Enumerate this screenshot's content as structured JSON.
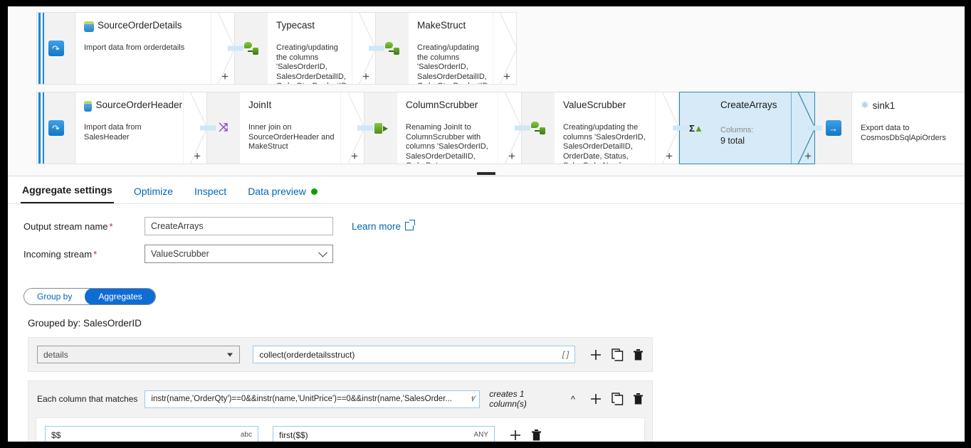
{
  "canvas": {
    "rows": [
      {
        "source": {
          "icon": "sql-database-icon",
          "title": "SourceOrderDetails",
          "desc": "Import data from orderdetails",
          "handle_icon": "source-import-icon"
        },
        "nodes": [
          {
            "conn_icon": "derived-column-icon",
            "title": "Typecast",
            "desc": "Creating/updating the columns 'SalesOrderID, SalesOrderDetailID, OrderQty, ProductID, UnitPrice,"
          },
          {
            "conn_icon": "derived-column-icon",
            "title": "MakeStruct",
            "desc": "Creating/updating the columns 'SalesOrderID, SalesOrderDetailID, OrderQty, ProductID, UnitPrice,"
          }
        ]
      },
      {
        "source": {
          "icon": "sql-database-icon",
          "title": "SourceOrderHeader",
          "desc": "Import data from SalesHeader",
          "handle_icon": "source-import-icon"
        },
        "nodes": [
          {
            "conn_icon": "join-icon",
            "title": "JoinIt",
            "desc": "Inner join on SourceOrderHeader and MakeStruct"
          },
          {
            "conn_icon": "select-icon",
            "title": "ColumnScrubber",
            "desc": "Renaming JoinIt to ColumnScrubber with columns 'SalesOrderID, SalesOrderDetailID, OrderDate,"
          },
          {
            "conn_icon": "derived-column-icon",
            "title": "ValueScrubber",
            "desc": "Creating/updating the columns 'SalesOrderID, SalesOrderDetailID, OrderDate, Status, SalesOrderNumber,"
          },
          {
            "conn_icon": "aggregate-icon",
            "title": "CreateArrays",
            "sub_label": "Columns:",
            "sub_value": "9 total",
            "selected": true
          }
        ],
        "sink": {
          "icon": "cosmos-db-icon",
          "title": "sink1",
          "desc": "Export data to CosmosDbSqlApiOrders",
          "handle_icon": "sink-export-icon"
        }
      }
    ],
    "add_label": "+"
  },
  "tabs": [
    {
      "label": "Aggregate settings",
      "active": true,
      "status_dot": false
    },
    {
      "label": "Optimize",
      "active": false,
      "status_dot": false
    },
    {
      "label": "Inspect",
      "active": false,
      "status_dot": false
    },
    {
      "label": "Data preview",
      "active": false,
      "status_dot": true
    }
  ],
  "settings": {
    "output_stream": {
      "label": "Output stream name",
      "required": "*",
      "value": "CreateArrays"
    },
    "incoming_stream": {
      "label": "Incoming stream",
      "required": "*",
      "value": "ValueScrubber"
    },
    "learn_more": "Learn more",
    "pivot": {
      "group_by": "Group by",
      "aggregates": "Aggregates",
      "selected": "Aggregates"
    },
    "grouped_by": "Grouped by: SalesOrderID",
    "aggregate_rows": [
      {
        "column": "details",
        "expression": "collect(orderdetailsstruct)",
        "expression_hint": "[ ]"
      }
    ],
    "rule_based": {
      "label": "Each column that matches",
      "expression": "instr(name,'OrderQty')==0&&instr(name,'UnitPrice')==0&&instr(name,'SalesOrder...",
      "fx_icon": "expression-builder-icon",
      "creates": "creates 1 column(s)",
      "collapse_icon": "chevron-up-icon",
      "name_field": {
        "value": "$$",
        "type_hint": "abc"
      },
      "value_field": {
        "value": "first($$)",
        "type_hint": "ANY"
      }
    }
  },
  "icons": {
    "add": "plus-icon",
    "duplicate": "copy-icon",
    "delete": "trash-icon"
  },
  "colors": {
    "accent_blue": "#0067b8",
    "selected_node_fill": "#d6eaf7",
    "selected_node_border": "#2e86ab",
    "pivot_on": "#0f6cd4",
    "status_green": "#0a9e0a",
    "required_red": "#c1272d",
    "connector_blue": "#1b8ad6"
  }
}
